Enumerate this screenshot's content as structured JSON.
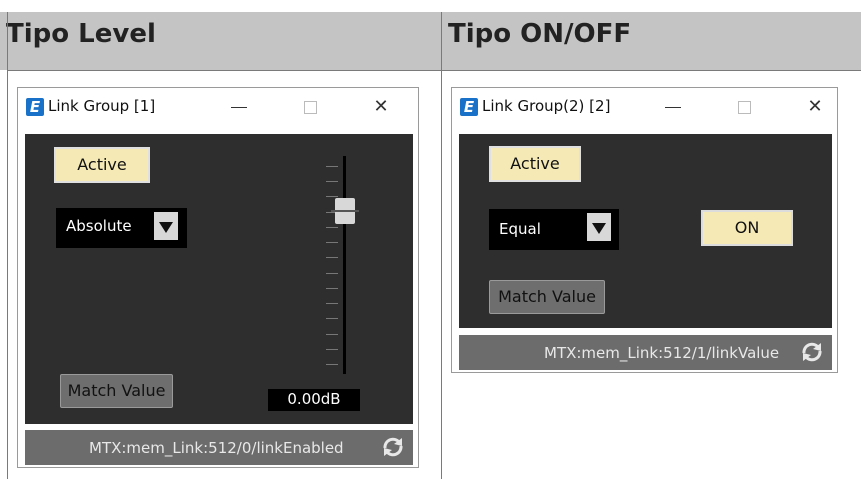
{
  "columns": [
    {
      "header": "Tipo Level"
    },
    {
      "header": "Tipo ON/OFF"
    }
  ],
  "level_window": {
    "title": "Link Group [1]",
    "active_label": "Active",
    "mode_value": "Absolute",
    "match_label": "Match Value",
    "fader_value": "0.00dB",
    "fader_level": 0.75,
    "status_text": "MTX:mem_Link:512/0/linkEnabled"
  },
  "onoff_window": {
    "title": "Link Group(2) [2]",
    "active_label": "Active",
    "mode_value": "Equal",
    "on_label": "ON",
    "match_label": "Match Value",
    "status_text": "MTX:mem_Link:512/1/linkValue"
  },
  "icons": {
    "app": "app-logo-icon",
    "minimize": "minimize-icon",
    "maximize": "maximize-icon",
    "close": "close-icon",
    "dropdown": "dropdown-arrow-icon",
    "sync": "sync-icon"
  }
}
